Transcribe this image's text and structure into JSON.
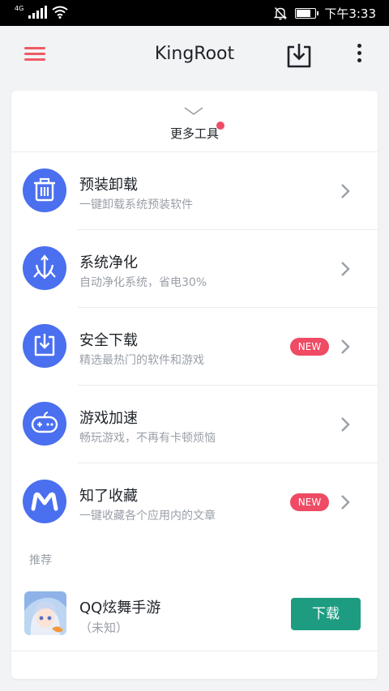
{
  "status_bar": {
    "network_label": "4G",
    "time": "下午3:33",
    "icons": [
      "signal-icon",
      "wifi-icon",
      "mute-bell-icon",
      "battery-icon"
    ]
  },
  "app_bar": {
    "title": "KingRoot",
    "icons": [
      "menu-icon",
      "download-tray-icon",
      "more-options-icon"
    ],
    "accent_color": "#ef5a63"
  },
  "more_tools": {
    "label": "更多工具",
    "has_notification_dot": true
  },
  "tools": [
    {
      "title": "预装卸载",
      "subtitle": "一键卸载系统预装软件",
      "icon": "trash-icon",
      "badge": ""
    },
    {
      "title": "系统净化",
      "subtitle": "自动净化系统，省电30%",
      "icon": "purify-icon",
      "badge": ""
    },
    {
      "title": "安全下载",
      "subtitle": "精选最热门的软件和游戏",
      "icon": "download-icon",
      "badge": "NEW"
    },
    {
      "title": "游戏加速",
      "subtitle": "畅玩游戏，不再有卡顿烦恼",
      "icon": "gamepad-icon",
      "badge": ""
    },
    {
      "title": "知了收藏",
      "subtitle": "一键收藏各个应用内的文章",
      "icon": "m-logo-icon",
      "badge": "NEW"
    }
  ],
  "recommend": {
    "label": "推荐",
    "app": {
      "name": "QQ炫舞手游",
      "status": "（未知）",
      "button_label": "下载"
    }
  },
  "colors": {
    "tool_icon_bg": "#4a6fef",
    "badge": "#ef4b64",
    "download_button": "#1e9c81",
    "page_bg": "#f2f3f5"
  }
}
